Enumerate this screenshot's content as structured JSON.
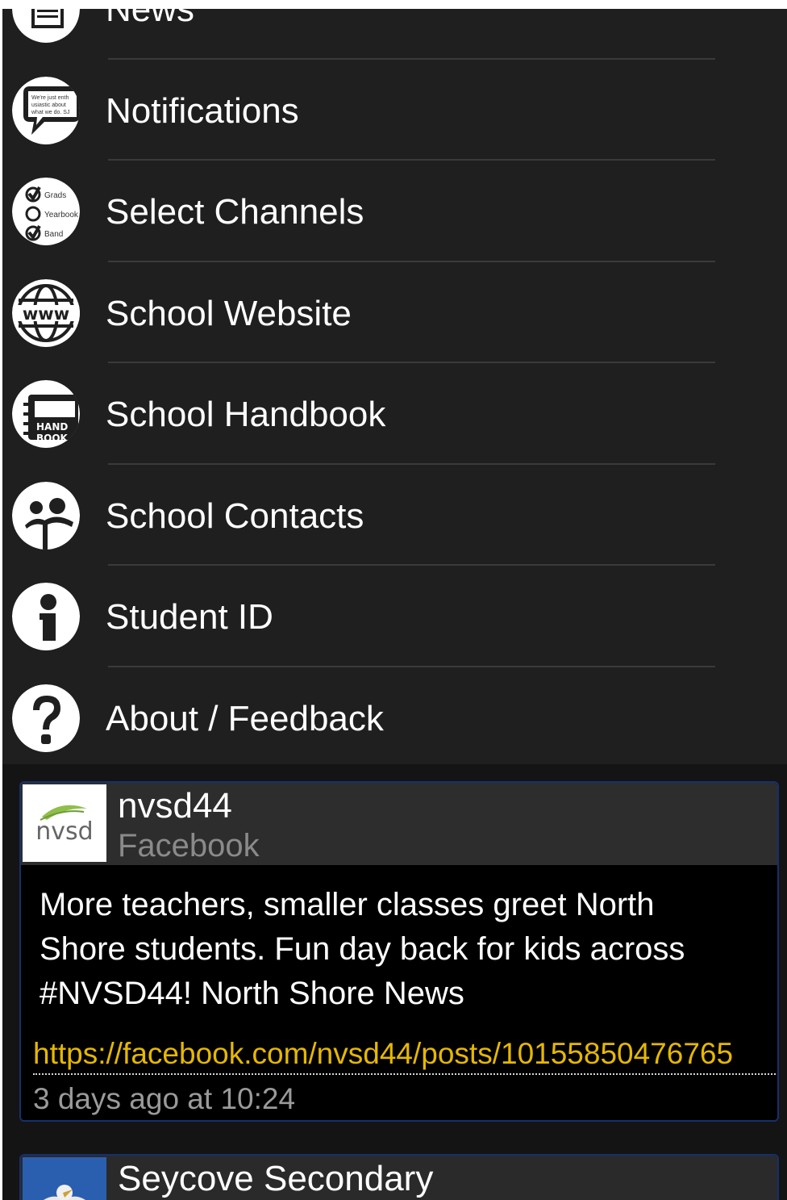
{
  "menu": {
    "items": [
      {
        "label": "News",
        "icon": "newspaper-icon"
      },
      {
        "label": "Notifications",
        "icon": "speech-bubble-icon",
        "icon_text": "We're just enthusiastic about what we do. SJ"
      },
      {
        "label": "Select Channels",
        "icon": "checklist-icon",
        "icon_text": [
          "Grads",
          "Yearbook",
          "Band"
        ]
      },
      {
        "label": "School Website",
        "icon": "globe-www-icon",
        "icon_text": "www"
      },
      {
        "label": "School Handbook",
        "icon": "handbook-icon",
        "icon_text": [
          "HAND",
          "BOOK"
        ]
      },
      {
        "label": "School Contacts",
        "icon": "contacts-icon"
      },
      {
        "label": "Student ID",
        "icon": "info-icon"
      },
      {
        "label": "About / Feedback",
        "icon": "question-icon"
      }
    ]
  },
  "feed": {
    "posts": [
      {
        "author": "nvsd44",
        "source": "Facebook",
        "avatar_text": "nvsd",
        "text": "More teachers, smaller classes greet North Shore students. Fun day back for kids across #NVSD44! North Shore News",
        "link": "https://facebook.com/nvsd44/posts/10155850476765",
        "time": "3 days ago at 10:24"
      },
      {
        "author": "Seycove Secondary",
        "avatar_icon": "eagle-crest-icon"
      }
    ]
  },
  "colors": {
    "menu_background": "#1f1f1f",
    "feed_background": "#141414",
    "card_border": "#16306e",
    "link": "#e6b800"
  }
}
